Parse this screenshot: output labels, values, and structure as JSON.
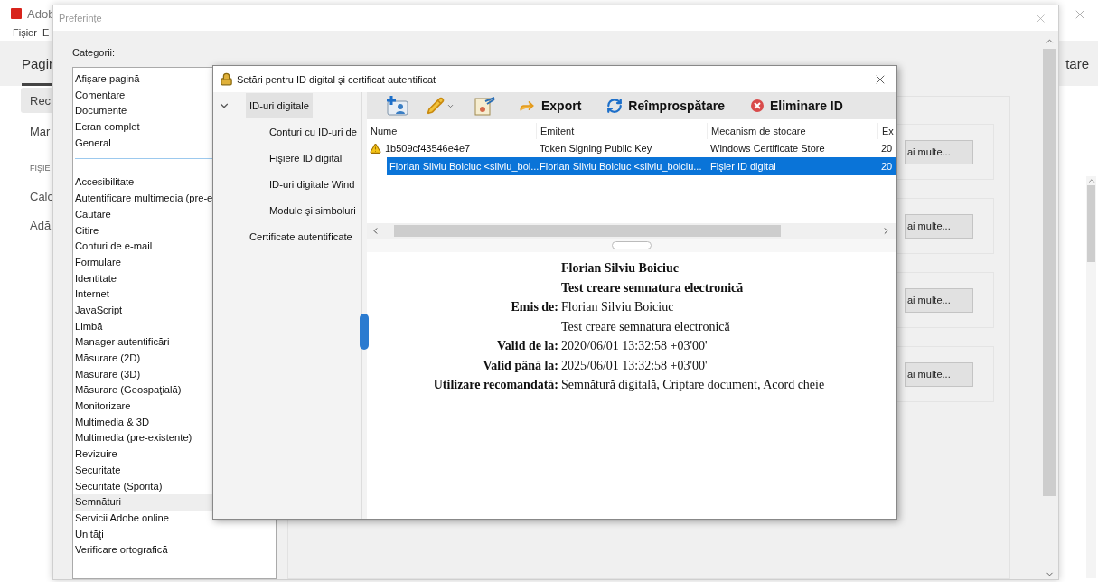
{
  "app": {
    "title": "Adob",
    "menu": [
      "Fişier",
      "E"
    ],
    "tabs": [
      {
        "label": "Pagir",
        "selected": true
      },
      {
        "label": "tare",
        "selected": false
      }
    ],
    "sidebar": [
      {
        "label": "Rec",
        "selected": true
      },
      {
        "label": "Mar",
        "selected": false
      }
    ],
    "section": "FIŞIE",
    "tools": [
      "Calc",
      "Adă"
    ]
  },
  "preferences": {
    "title": "Preferinţe",
    "categories_label": "Categorii:",
    "top_categories": [
      {
        "label": "Afişare pagină",
        "selected": false
      },
      {
        "label": "Comentare",
        "selected": false
      },
      {
        "label": "Documente",
        "selected": false
      },
      {
        "label": "Ecran complet",
        "selected": false
      },
      {
        "label": "General",
        "selected": false
      }
    ],
    "categories": [
      {
        "label": "Accesibilitate",
        "selected": false
      },
      {
        "label": "Autentificare multimedia (pre-e",
        "selected": false
      },
      {
        "label": "Căutare",
        "selected": false
      },
      {
        "label": "Citire",
        "selected": false
      },
      {
        "label": "Conturi de e-mail",
        "selected": false
      },
      {
        "label": "Formulare",
        "selected": false
      },
      {
        "label": "Identitate",
        "selected": false
      },
      {
        "label": "Internet",
        "selected": false
      },
      {
        "label": "JavaScript",
        "selected": false
      },
      {
        "label": "Limbă",
        "selected": false
      },
      {
        "label": "Manager autentificări",
        "selected": false
      },
      {
        "label": "Măsurare (2D)",
        "selected": false
      },
      {
        "label": "Măsurare (3D)",
        "selected": false
      },
      {
        "label": "Măsurare (Geospaţială)",
        "selected": false
      },
      {
        "label": "Monitorizare",
        "selected": false
      },
      {
        "label": "Multimedia & 3D",
        "selected": false
      },
      {
        "label": "Multimedia (pre-existente)",
        "selected": false
      },
      {
        "label": "Revizuire",
        "selected": false
      },
      {
        "label": "Securitate",
        "selected": false
      },
      {
        "label": "Securitate (Sporită)",
        "selected": false
      },
      {
        "label": "Semnături",
        "selected": true
      },
      {
        "label": "Servicii Adobe online",
        "selected": false
      },
      {
        "label": "Unităţi",
        "selected": false
      },
      {
        "label": "Verificare ortografică",
        "selected": false
      }
    ],
    "more_buttons": [
      "ai multe...",
      "ai multe...",
      "ai multe...",
      "ai multe..."
    ]
  },
  "id_dialog": {
    "title": "Setări pentru ID digital şi certificat autentificat",
    "tree": [
      {
        "label": "ID-uri digitale",
        "selected": true,
        "expanded": true,
        "children": [
          {
            "label": "Conturi cu ID-uri de",
            "selected": false
          },
          {
            "label": "Fişiere ID digital",
            "selected": false
          },
          {
            "label": "ID-uri digitale Wind",
            "selected": false
          },
          {
            "label": "Module şi simboluri",
            "selected": false
          }
        ]
      },
      {
        "label": "Certificate autentificate",
        "selected": false,
        "expanded": false
      }
    ],
    "actions": [
      "Export",
      "Reîmprospătare",
      "Eliminare ID"
    ],
    "columns": [
      "Nume",
      "Emitent",
      "Mecanism de stocare",
      "Ex"
    ],
    "rows": [
      {
        "warning": true,
        "selected": false,
        "cells": [
          "1b509cf43546e4e7",
          "Token Signing Public Key",
          "Windows Certificate Store",
          "20"
        ]
      },
      {
        "warning": false,
        "selected": true,
        "cells": [
          "Florian Silviu Boiciuc <silviu_boi...",
          "Florian Silviu Boiciuc <silviu_boiciu...",
          "Fişier ID digital",
          "20"
        ]
      }
    ],
    "details": [
      {
        "kind": "heading",
        "value": "Florian Silviu Boiciuc"
      },
      {
        "kind": "heading",
        "value": "Test creare semnatura electronică"
      },
      {
        "kind": "field",
        "label": "Emis de:",
        "value": "Florian Silviu Boiciuc"
      },
      {
        "kind": "continuation",
        "value": "Test creare semnatura electronică"
      },
      {
        "kind": "field",
        "label": "Valid de la:",
        "value": "2020/06/01 13:32:58 +03'00'"
      },
      {
        "kind": "field",
        "label": "Valid până la:",
        "value": "2025/06/01 13:32:58 +03'00'"
      },
      {
        "kind": "field",
        "label": "Utilizare recomandată:",
        "value": "Semnătură digitală, Criptare document, Acord cheie"
      }
    ]
  }
}
